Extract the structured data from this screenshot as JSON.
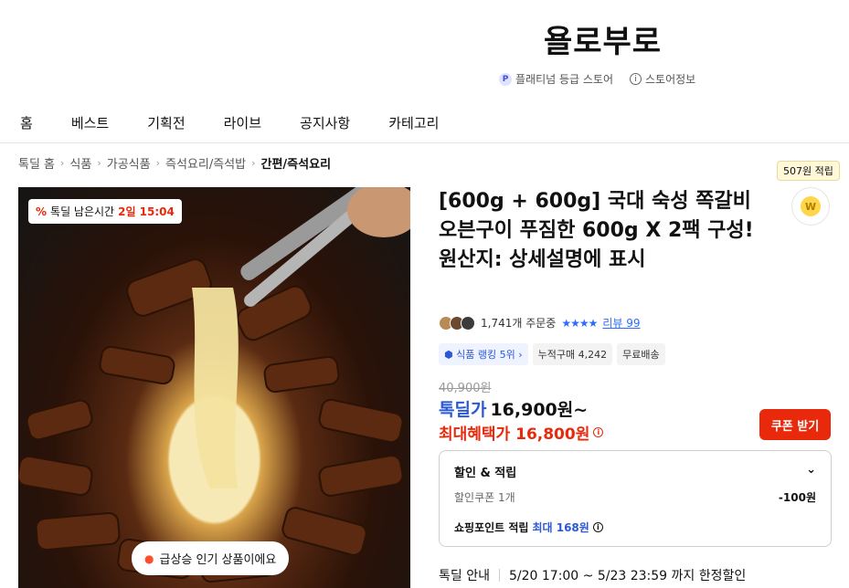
{
  "store": {
    "name": "욜로부로",
    "grade": "플래티넘 등급 스토어",
    "grade_icon": "P",
    "info": "스토어정보"
  },
  "nav": [
    "홈",
    "베스트",
    "기획전",
    "라이브",
    "공지사항",
    "카테고리"
  ],
  "breadcrumb": [
    "톡딜 홈",
    "식품",
    "가공식품",
    "즉석요리/즉석밥",
    "간편/즉석요리"
  ],
  "hero": {
    "timer_label": "톡딜 남은시간",
    "timer_value": "2일 15:04",
    "hot_label": "급상승 인기 상품이에요"
  },
  "reward": {
    "label": "507원 적립",
    "coin": "W"
  },
  "product": {
    "title": "[600g + 600g] 국대 숙성 쪽갈비 오븐구이 푸짐한 600g X 2팩 구성! 원산지: 상세설명에 표시",
    "order_count": "1,741개 주문중",
    "stars": "★★★★",
    "review_label": "리뷰 99",
    "tags": [
      "식품 랭킹 5위",
      "누적구매 4,242",
      "무료배송"
    ],
    "original_price": "40,900원",
    "deal_label": "톡딜가",
    "deal_price": "16,900원~",
    "max_benefit": "최대혜택가 16,800원",
    "coupon_button": "쿠폰 받기"
  },
  "discount": {
    "title": "할인 & 적립",
    "coupon_label": "할인쿠폰 1개",
    "coupon_value": "-100원",
    "points_label": "쇼핑포인트 적립",
    "points_value": "최대 168원"
  },
  "deal_info": {
    "label": "톡딜 안내",
    "period": "5/20 17:00 ~ 5/23 23:59 까지 한정할인"
  },
  "colors": {
    "accent_red": "#e8290b",
    "accent_blue": "#2b59d6"
  }
}
